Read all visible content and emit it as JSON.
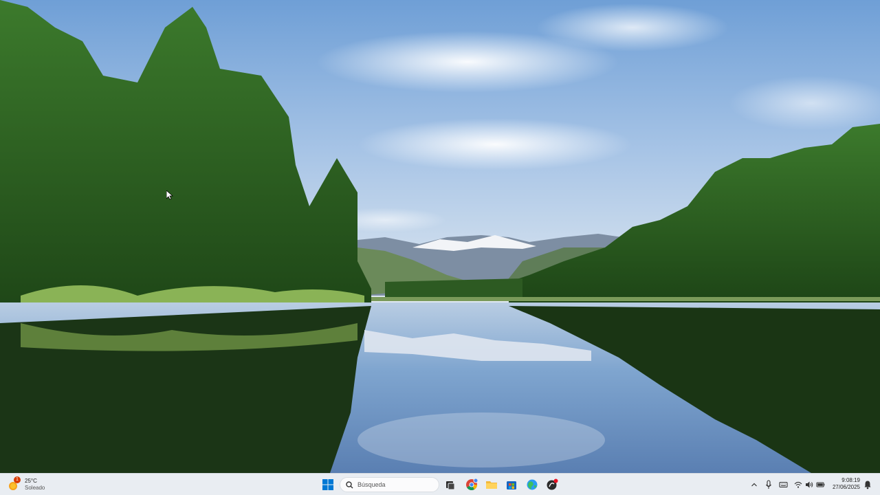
{
  "taskbar": {
    "weather": {
      "temperature": "25°C",
      "condition": "Soleado",
      "badge": "1",
      "icon": "sun-weather-icon"
    },
    "start_icon": "windows-start-icon",
    "search": {
      "placeholder": "Búsqueda",
      "icon": "search-icon"
    },
    "pinned_apps": [
      {
        "name": "task-view",
        "icon": "task-view-icon"
      },
      {
        "name": "chrome",
        "icon": "chrome-icon"
      },
      {
        "name": "file-explorer",
        "icon": "folder-icon"
      },
      {
        "name": "microsoft-store",
        "icon": "store-icon"
      },
      {
        "name": "browser",
        "icon": "globe-icon"
      },
      {
        "name": "app",
        "icon": "app-icon"
      }
    ],
    "tray": {
      "icons": [
        "chevron-up-icon",
        "microphone-icon",
        "keyboard-icon",
        "wifi-icon",
        "volume-icon",
        "battery-icon"
      ],
      "time": "9:08:19",
      "date": "27/06/2025",
      "notification_icon": "bell-icon"
    }
  },
  "colors": {
    "taskbar_bg": "#e9edf2",
    "accent": "#0078d4"
  }
}
